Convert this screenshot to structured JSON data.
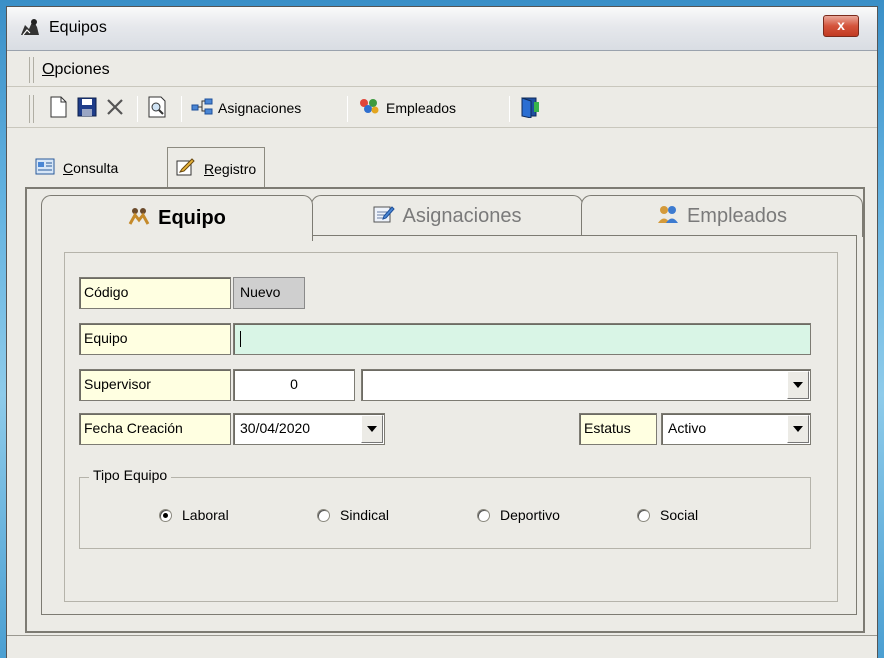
{
  "window": {
    "title": "Equipos",
    "close_glyph": "x"
  },
  "menu": {
    "items": [
      {
        "label": "Opciones",
        "accel": "O",
        "rest": "pciones"
      }
    ]
  },
  "toolbar": {
    "assignments_label": "Asignaciones",
    "employees_label": "Empleados",
    "icons": [
      "new-document-icon",
      "save-icon",
      "delete-icon",
      "preview-icon",
      "assignments-icon",
      "employees-icon",
      "exit-icon"
    ]
  },
  "outer_tabs": [
    {
      "label": "Consulta",
      "accel": "C",
      "rest": "onsulta",
      "active": false
    },
    {
      "label": "Registro",
      "accel": "R",
      "rest": "egistro",
      "active": true
    }
  ],
  "inner_tabs": [
    {
      "label": "Equipo",
      "active": true
    },
    {
      "label": "Asignaciones",
      "active": false
    },
    {
      "label": "Empleados",
      "active": false
    }
  ],
  "form": {
    "codigo_label": "Código",
    "codigo_value": "Nuevo",
    "equipo_label": "Equipo",
    "equipo_value": "",
    "supervisor_label": "Supervisor",
    "supervisor_id": "0",
    "supervisor_name": "",
    "fecha_label": "Fecha  Creación",
    "fecha_value": "30/04/2020",
    "estatus_label": "Estatus",
    "estatus_value": "Activo",
    "tipo_label": "Tipo Equipo",
    "tipo_options": [
      {
        "label": "Laboral",
        "checked": true
      },
      {
        "label": "Sindical",
        "checked": false
      },
      {
        "label": "Deportivo",
        "checked": false
      },
      {
        "label": "Social",
        "checked": false
      }
    ]
  },
  "colors": {
    "label_bg": "#ffffe1",
    "equipo_field_bg": "#d9f5e6",
    "readonly_bg": "#cfcfcf",
    "window_bg": "#ecebe6"
  }
}
